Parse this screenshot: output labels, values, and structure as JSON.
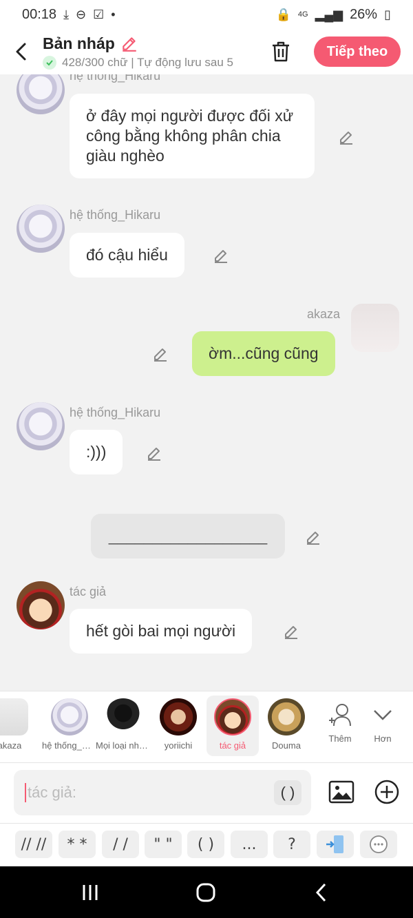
{
  "status_bar": {
    "time": "00:18",
    "network": "4G",
    "battery": "26%"
  },
  "header": {
    "title": "Bản nháp",
    "subtitle": "428/300 chữ | Tự động lưu sau 5",
    "next_label": "Tiếp theo"
  },
  "messages": [
    {
      "sender": "hệ thống_Hikaru",
      "text": "ở đây mọi người được đối xử công bằng không phân chia giàu nghèo"
    },
    {
      "sender": "hệ thống_Hikaru",
      "text": "đó cậu hiểu"
    },
    {
      "sender": "akaza",
      "text": "ờm...cũng cũng"
    },
    {
      "sender": "hệ thống_Hikaru",
      "text": ":)))"
    },
    {
      "sender": "",
      "text": "__________________"
    },
    {
      "sender": "tác giả",
      "text": "hết gòi bai mọi người"
    }
  ],
  "characters": [
    {
      "name": "akaza"
    },
    {
      "name": "hệ thống_Hikaru"
    },
    {
      "name": "Mọi loại nhân vật"
    },
    {
      "name": "yoriichi"
    },
    {
      "name": "tác giả"
    },
    {
      "name": "Douma"
    }
  ],
  "more_actions": {
    "add_label": "Thêm",
    "more_label": "Hơn"
  },
  "input": {
    "placeholder": "tác giả:",
    "paren_label": "( )"
  },
  "format_buttons": [
    "// //",
    "* *",
    "/ /",
    "\" \"",
    "( )",
    "...",
    "?"
  ],
  "colors": {
    "accent": "#f55a72",
    "bubble_self": "#cdf08e",
    "background": "#f2f2f2"
  },
  "icons": {
    "back": "chevron-left-icon",
    "edit": "pencil-icon",
    "trash": "trash-icon",
    "check": "check-icon",
    "image": "image-icon",
    "plus": "plus-circle-icon",
    "add_person": "add-person-icon",
    "chevron_down": "chevron-down-icon"
  }
}
